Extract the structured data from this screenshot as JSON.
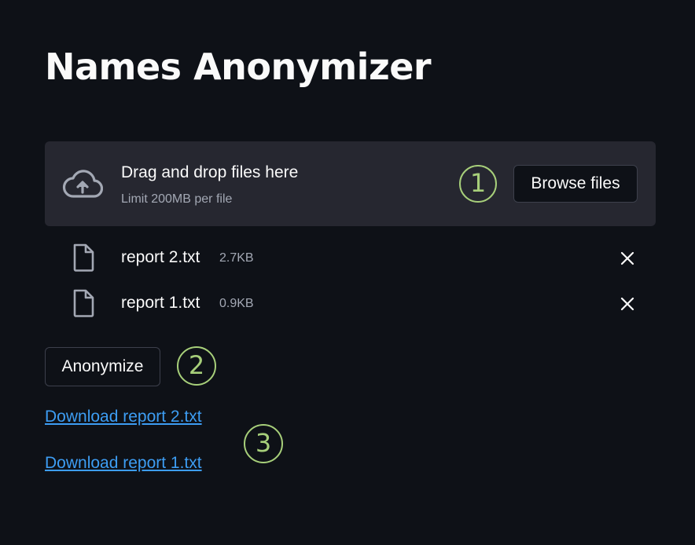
{
  "app": {
    "title": "Names Anonymizer"
  },
  "uploader": {
    "drop_label": "Drag and drop files here",
    "limit_label": "Limit 200MB per file",
    "browse_label": "Browse files",
    "icon": "cloud-upload-icon"
  },
  "files": [
    {
      "name": "report 2.txt",
      "size": "2.7KB",
      "icon": "file-icon"
    },
    {
      "name": "report 1.txt",
      "size": "0.9KB",
      "icon": "file-icon"
    }
  ],
  "actions": {
    "anonymize_label": "Anonymize"
  },
  "downloads": [
    {
      "label": "Download report 2.txt"
    },
    {
      "label": "Download report 1.txt"
    }
  ],
  "callouts": {
    "one": "1",
    "two": "2",
    "three": "3"
  },
  "colors": {
    "background": "#0e1117",
    "dropzone": "#262730",
    "callout": "#a7cf7a",
    "link": "#3d9df3",
    "muted_text": "#a3a8b4"
  }
}
